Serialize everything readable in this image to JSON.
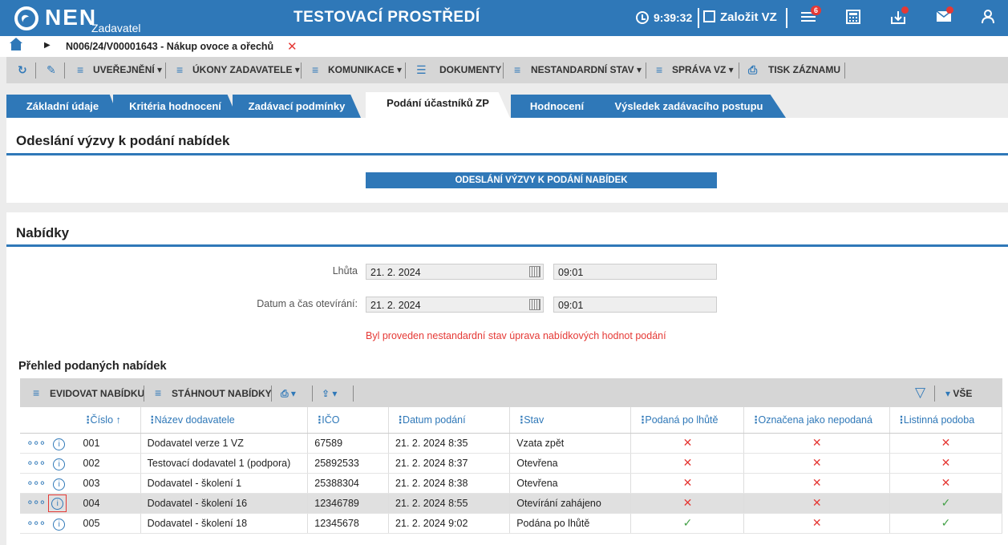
{
  "header": {
    "logo_text": "NEN",
    "logo_sub": "Zadavatel",
    "env_title": "TESTOVACÍ PROSTŘEDÍ",
    "time": "9:39:32",
    "create_label": "Založit VZ",
    "notif_count": "6"
  },
  "breadcrumb": {
    "path": "N006/24/V00001643 - Nákup ovoce a ořechů",
    "close": "✕"
  },
  "toolbar": {
    "items": [
      "UVEŘEJNĚNÍ",
      "ÚKONY ZADAVATELE",
      "KOMUNIKACE",
      "DOKUMENTY",
      "NESTANDARDNÍ STAV",
      "SPRÁVA VZ",
      "TISK ZÁZNAMU"
    ]
  },
  "tabs": [
    "Základní údaje",
    "Kritéria hodnocení",
    "Zadávací podmínky",
    "Podání účastníků ZP",
    "Hodnocení",
    "Výsledek zadávacího postupu"
  ],
  "section_invite": {
    "title": "Odeslání výzvy k podání nabídek",
    "button": "ODESLÁNÍ VÝZVY K PODÁNÍ NABÍDEK"
  },
  "section_offers": {
    "title": "Nabídky",
    "deadline_label": "Lhůta",
    "deadline_date": "21. 2. 2024",
    "deadline_time": "09:01",
    "opening_label": "Datum a čas otevírání:",
    "opening_date": "21. 2. 2024",
    "opening_time": "09:01",
    "warning": "Byl proveden nestandardní stav úprava nabídkových hodnot podání",
    "overview_title": "Přehled podaných nabídek"
  },
  "grid_toolbar": {
    "register": "EVIDOVAT NABÍDKU",
    "download": "STÁHNOUT NABÍDKY",
    "all": "VŠE"
  },
  "grid": {
    "columns": [
      "Číslo ↑",
      "Název dodavatele",
      "IČO",
      "Datum podání",
      "Stav",
      "Podaná po lhůtě",
      "Označena jako nepodaná",
      "Listinná podoba"
    ],
    "rows": [
      {
        "no": "001",
        "name": "Dodavatel verze 1 VZ",
        "ico": "67589",
        "date": "21. 2. 2024 8:35",
        "status": "Vzata zpět",
        "late": "✕",
        "unsubmitted": "✕",
        "paper": "✕"
      },
      {
        "no": "002",
        "name": "Testovací dodavatel 1 (podpora)",
        "ico": "25892533",
        "date": "21. 2. 2024 8:37",
        "status": "Otevřena",
        "late": "✕",
        "unsubmitted": "✕",
        "paper": "✕"
      },
      {
        "no": "003",
        "name": "Dodavatel - školení 1",
        "ico": "25388304",
        "date": "21. 2. 2024 8:38",
        "status": "Otevřena",
        "late": "✕",
        "unsubmitted": "✕",
        "paper": "✕"
      },
      {
        "no": "004",
        "name": "Dodavatel - školení 16",
        "ico": "12346789",
        "date": "21. 2. 2024 8:55",
        "status": "Otevírání zahájeno",
        "late": "✕",
        "unsubmitted": "✕",
        "paper": "✓"
      },
      {
        "no": "005",
        "name": "Dodavatel - školení 18",
        "ico": "12345678",
        "date": "21. 2. 2024 9:02",
        "status": "Podána po lhůtě",
        "late": "✓",
        "unsubmitted": "✕",
        "paper": "✓"
      }
    ]
  },
  "colors": {
    "primary": "#2f78b8",
    "error": "#e53935",
    "success": "#43a047"
  }
}
